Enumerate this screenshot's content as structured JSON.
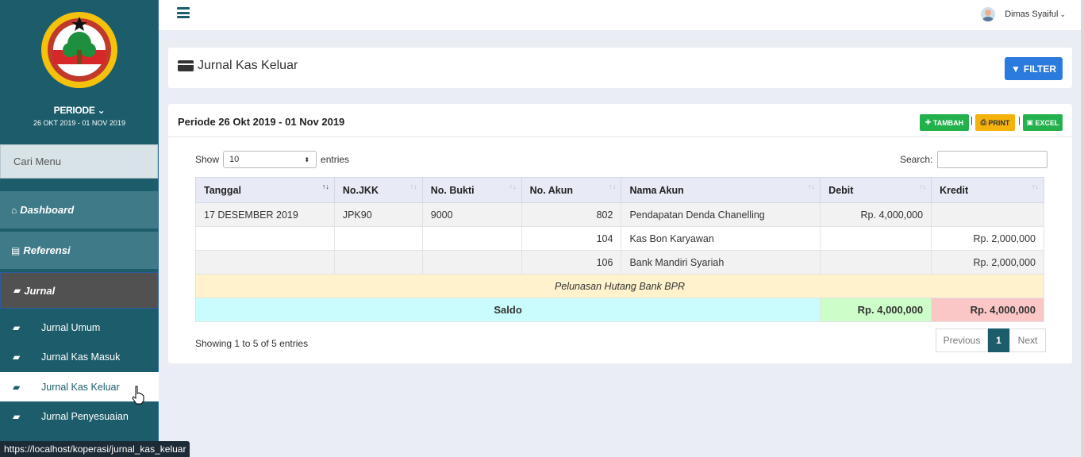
{
  "sidebar": {
    "periode_title": "PERIODE",
    "periode_range": "26 OKT 2019 - 01 NOV 2019",
    "search_placeholder": "Cari Menu",
    "sections": {
      "dashboard": "Dashboard",
      "referensi": "Referensi",
      "jurnal": "Jurnal"
    },
    "jurnal_items": [
      "Jurnal Umum",
      "Jurnal Kas Masuk",
      "Jurnal Kas Keluar",
      "Jurnal Penyesuaian"
    ],
    "active_item": "Jurnal Kas Keluar"
  },
  "status_url": "https://localhost/koperasi/jurnal_kas_keluar",
  "topbar": {
    "user_name": "Dimas Syaiful"
  },
  "page": {
    "title": "Jurnal Kas Keluar",
    "filter_label": "FILTER"
  },
  "panel": {
    "periode_label": "Periode 26 Okt 2019 - 01 Nov 2019",
    "actions": {
      "tambah": "TAMBAH",
      "print": "PRINT",
      "excel": "EXCEL"
    },
    "show_label": "Show",
    "entries_value": "10",
    "entries_label": "entries",
    "search_label": "Search:"
  },
  "table": {
    "headers": [
      "Tanggal",
      "No.JKK",
      "No. Bukti",
      "No. Akun",
      "Nama Akun",
      "Debit",
      "Kredit"
    ],
    "rows": [
      [
        "17 DESEMBER 2019",
        "JPK90",
        "9000",
        "802",
        "Pendapatan Denda Chanelling",
        "Rp. 4,000,000",
        ""
      ],
      [
        "",
        "",
        "",
        "104",
        "Kas Bon Karyawan",
        "",
        "Rp. 2,000,000"
      ],
      [
        "",
        "",
        "",
        "106",
        "Bank Mandiri Syariah",
        "",
        "Rp. 2,000,000"
      ]
    ],
    "description": "Pelunasan Hutang Bank BPR",
    "saldo": {
      "label": "Saldo",
      "debit": "Rp. 4,000,000",
      "kredit": "Rp. 4,000,000"
    }
  },
  "footer": {
    "info": "Showing 1 to 5 of 5 entries",
    "pagination": {
      "previous": "Previous",
      "current": "1",
      "next": "Next"
    }
  },
  "colors": {
    "sidebar": "#1d5d6b",
    "primary": "#2b7bde",
    "success": "#23b14d",
    "warning": "#f4b20b"
  }
}
